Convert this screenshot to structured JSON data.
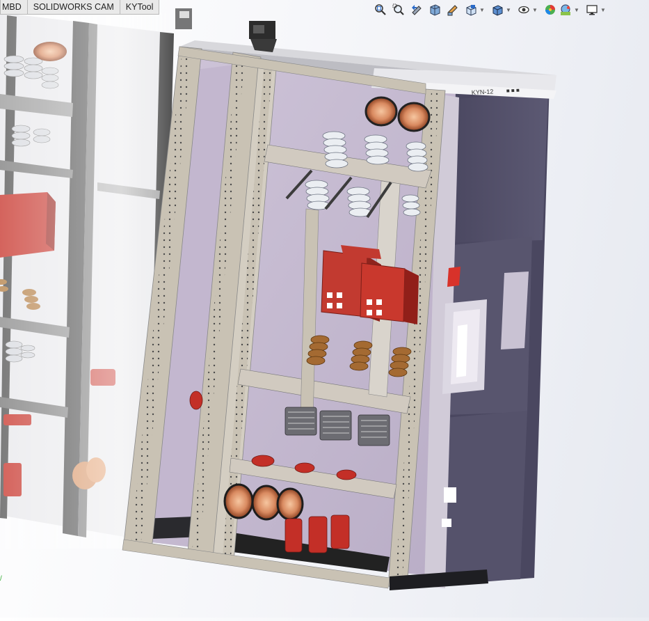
{
  "tabs": [
    {
      "label": "MBD"
    },
    {
      "label": "SOLIDWORKS CAM"
    },
    {
      "label": "KYTool"
    }
  ],
  "heads_up_toolbar": {
    "icons": [
      "zoom-to-fit-icon",
      "zoom-to-area-icon",
      "previous-view-icon",
      "section-view-icon",
      "dynamic-annotation-views-icon",
      "view-orientation-icon",
      "display-style-icon",
      "hide-show-items-icon",
      "edit-appearance-icon",
      "apply-scene-icon",
      "view-settings-icon"
    ]
  },
  "model": {
    "nameplate_text": "KYN-12",
    "nameplate_marks": "■ ■ ■"
  },
  "colors": {
    "frame": "#c9c2b4",
    "interior": "#c7bcd1",
    "panel": "#535068",
    "component_red": "#c23a30",
    "copper": "#c87955",
    "insulator_white": "#ebeef2",
    "insulator_brown": "#8a5a2a"
  }
}
